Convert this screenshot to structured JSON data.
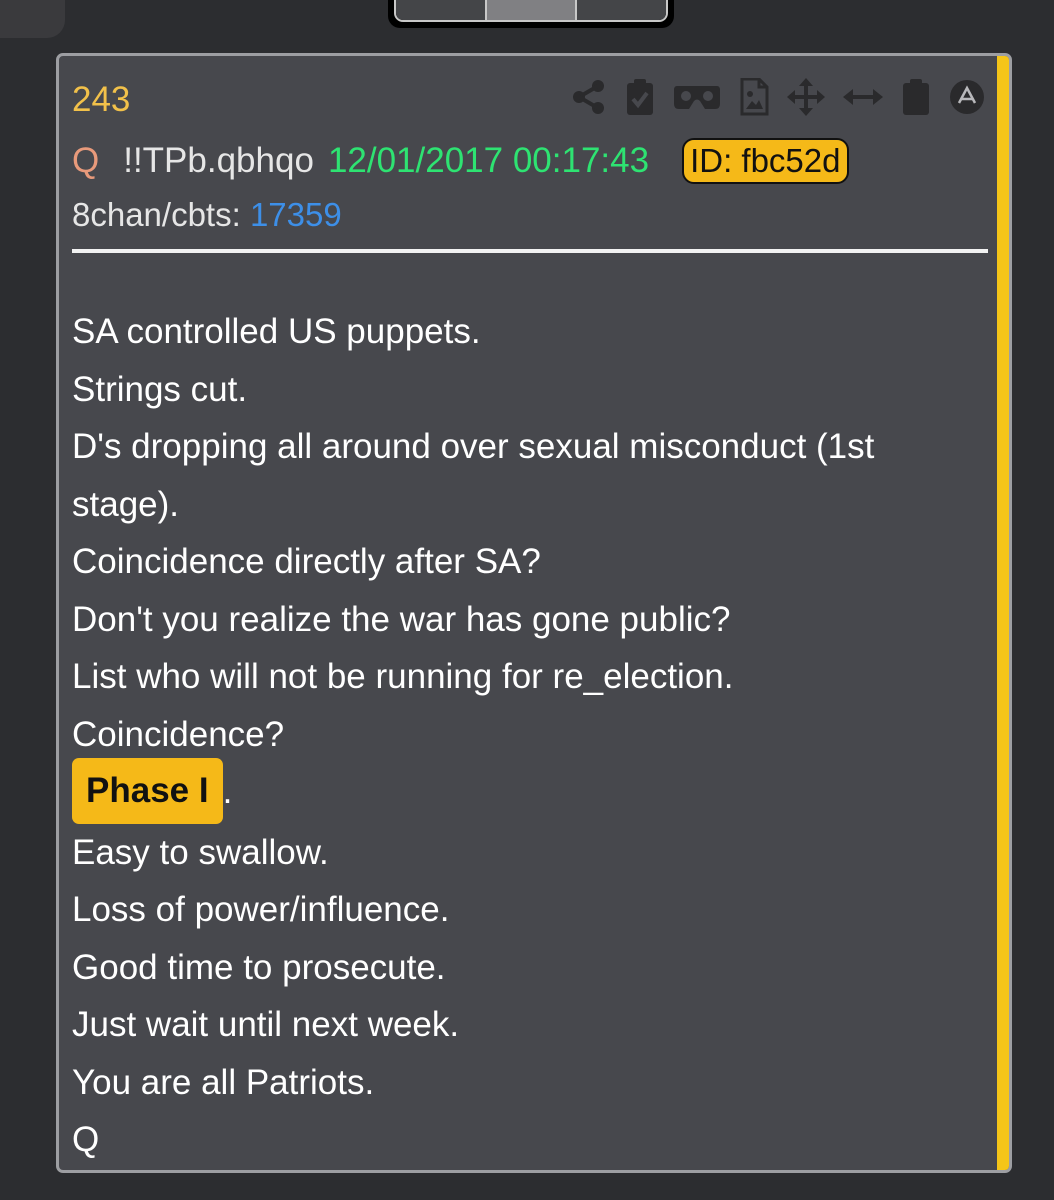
{
  "post": {
    "number": "243",
    "author": "Q",
    "tripcode": "!!TPb.qbhqo",
    "timestamp": "12/01/2017 00:17:43",
    "id_badge": "ID: fbc52d",
    "board_label": "8chan/cbts:",
    "board_link": "17359",
    "accent_color": "#f5c518",
    "body_lines": [
      "SA controlled US puppets.",
      "Strings cut.",
      "D's dropping all around over sexual misconduct (1st stage).",
      "Coincidence directly after SA?",
      "Don't you realize the war has gone public?",
      "List who will not be running for re_election.",
      "Coincidence?"
    ],
    "highlight_text": "Phase I",
    "highlight_suffix": ".",
    "body_lines_after": [
      "Easy to swallow.",
      "Loss of power/influence.",
      "Good time to prosecute.",
      "Just wait until next week.",
      "You are all Patriots.",
      "Q"
    ]
  },
  "toolbar_icons": [
    "share-icon",
    "clipboard-check-icon",
    "vr-goggles-icon",
    "image-file-icon",
    "move-arrows-icon",
    "horizontal-arrows-icon",
    "clipboard-icon",
    "circle-a-icon"
  ],
  "colors": {
    "background": "#2c2d30",
    "card": "#47484d",
    "post_number": "#f2c14a",
    "author": "#e89a7b",
    "timestamp": "#2ee372",
    "link": "#3d8fe8",
    "badge": "#f5b918"
  }
}
